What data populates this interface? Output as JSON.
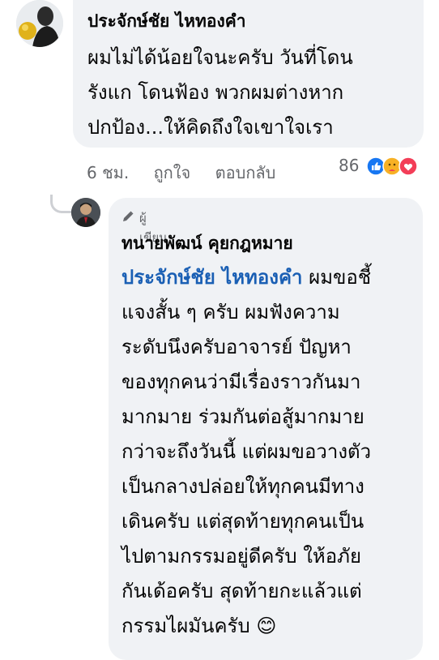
{
  "comment": {
    "author": "ประจักษ์ชัย ไหทองคำ",
    "lines": [
      "ผมไม่ได้น้อยใจนะครับ วันที่โดน",
      "รังแก โดนฟ้อง พวกผมต่างหาก",
      "ปกป้อง...ให้คิดถึงใจเขาใจเรา"
    ],
    "time": "6 ชม.",
    "like_label": "ถูกใจ",
    "reply_label": "ตอบกลับ",
    "reaction_count": "86",
    "reactions": [
      "like-icon",
      "care-icon",
      "love-icon"
    ]
  },
  "reply": {
    "badge": "ผู้เขียน",
    "author": "ทนายพัฒน์ คุยกฎหมาย",
    "mention": "ประจักษ์ชัย ไหทองคำ",
    "first_line_rest": " ผมขอชี้",
    "lines": [
      "แจงสั้น ๆ ครับ ผมฟังความ",
      "ระดับนึงครับอาจารย์ ปัญหา",
      "ของทุกคนว่ามีเรื่องราวกันมา",
      "มากมาย ร่วมกันต่อสู้มากมาย",
      "กว่าจะถึงวันนี้ แต่ผมขอวางตัว",
      "เป็นกลางปล่อยให้ทุกคนมีทาง",
      "เดินครับ แต่สุดท้ายทุกคนเป็น",
      "ไปตามกรรมอยู่ดีครับ  ให้อภัย",
      "กันเด้อครับ สุดท้ายกะแล้วแต่",
      "กรรมไผมันครับ"
    ],
    "emoji": "😊"
  }
}
